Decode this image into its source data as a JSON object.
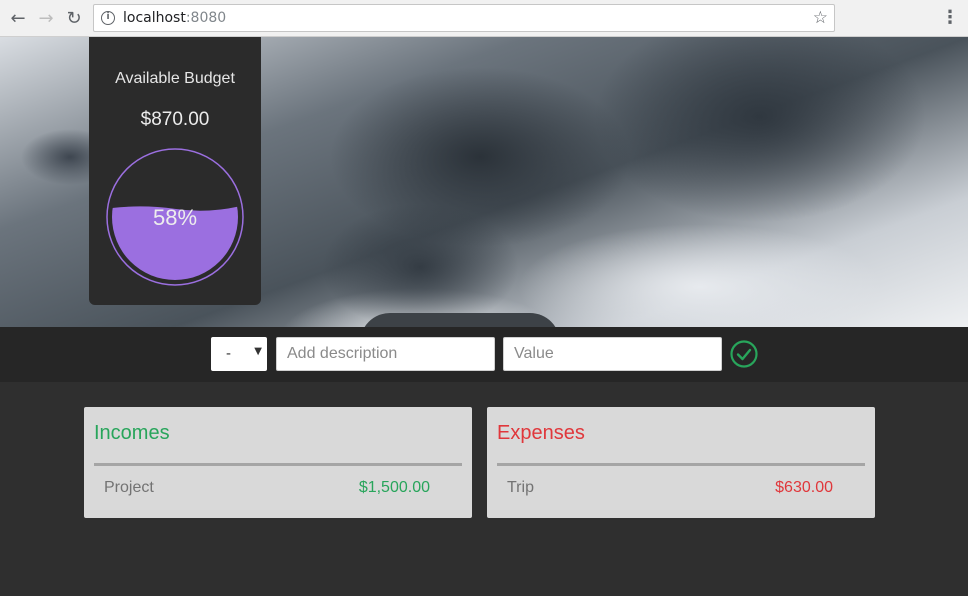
{
  "browser": {
    "url_host": "localhost",
    "url_port": ":8080"
  },
  "budget": {
    "title": "Available Budget",
    "amount": "$870.00",
    "percent_label": "58%",
    "percent_value": 0.58,
    "gauge_color": "#9b6fe0"
  },
  "entry": {
    "type_value": "-",
    "description_placeholder": "Add description",
    "value_placeholder": "Value",
    "confirm_color": "#28a55b"
  },
  "incomes": {
    "title": "Incomes",
    "color": "#28a55b",
    "items": [
      {
        "name": "Project",
        "amount": "$1,500.00"
      }
    ]
  },
  "expenses": {
    "title": "Expenses",
    "color": "#e0373b",
    "items": [
      {
        "name": "Trip",
        "amount": "$630.00"
      }
    ]
  }
}
